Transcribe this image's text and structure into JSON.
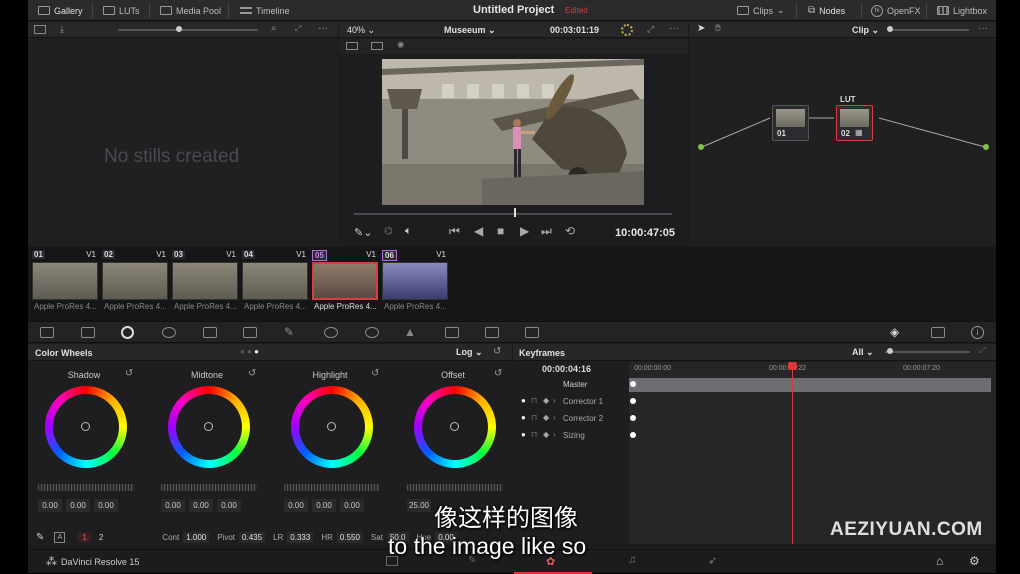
{
  "topbar": {
    "gallery": "Gallery",
    "luts": "LUTs",
    "media_pool": "Media Pool",
    "timeline": "Timeline",
    "project_title": "Untitled Project",
    "edited": "Edited",
    "clips": "Clips",
    "nodes": "Nodes",
    "openfx": "OpenFX",
    "lightbox": "Lightbox"
  },
  "gallery": {
    "empty": "No stills created"
  },
  "viewer": {
    "zoom": "40%",
    "timeline_name": "Museeum",
    "duration": "00:03:01:19",
    "timecode": "10:00:47:05"
  },
  "nodes": {
    "mode": "Clip",
    "node1": "01",
    "node2": "02",
    "node2_label": "LUT"
  },
  "clips": [
    {
      "num": "01",
      "track": "V1",
      "name": "Apple ProRes 4..."
    },
    {
      "num": "02",
      "track": "V1",
      "name": "Apple ProRes 4..."
    },
    {
      "num": "03",
      "track": "V1",
      "name": "Apple ProRes 4..."
    },
    {
      "num": "04",
      "track": "V1",
      "name": "Apple ProRes 4..."
    },
    {
      "num": "05",
      "track": "V1",
      "name": "Apple ProRes 4..."
    },
    {
      "num": "06",
      "track": "V1",
      "name": "Apple ProRes 4..."
    }
  ],
  "color_wheels": {
    "title": "Color Wheels",
    "mode": "Log",
    "wheels": [
      {
        "name": "Shadow",
        "v1": "0.00",
        "v2": "0.00",
        "v3": "0.00"
      },
      {
        "name": "Midtone",
        "v1": "0.00",
        "v2": "0.00",
        "v3": "0.00"
      },
      {
        "name": "Highlight",
        "v1": "0.00",
        "v2": "0.00",
        "v3": "0.00"
      },
      {
        "name": "Offset",
        "v1": "25.00",
        "v2": "",
        "v3": ""
      }
    ]
  },
  "params": {
    "page1": "1",
    "page2": "2",
    "cont_label": "Cont",
    "cont": "1.000",
    "pivot_label": "Pivot",
    "pivot": "0.435",
    "lr_label": "LR",
    "lr": "0.333",
    "hr_label": "HR",
    "hr": "0.550",
    "sat_label": "Sat",
    "sat": "50.0",
    "hue_label": "Hue",
    "hue": "0.00"
  },
  "keyframes": {
    "title": "Keyframes",
    "filter": "All",
    "current": "00:00:04:16",
    "t0": "00:00:00:00",
    "t1": "00:00:03:22",
    "t2": "00:00:07:20",
    "rows": [
      "Master",
      "Corrector 1",
      "Corrector 2",
      "Sizing"
    ]
  },
  "footer": {
    "app_name": "DaVinci Resolve 15"
  },
  "subtitles": {
    "line1": "像这样的图像",
    "line2": "to the image like so"
  },
  "watermark": "AEZIYUAN.COM"
}
